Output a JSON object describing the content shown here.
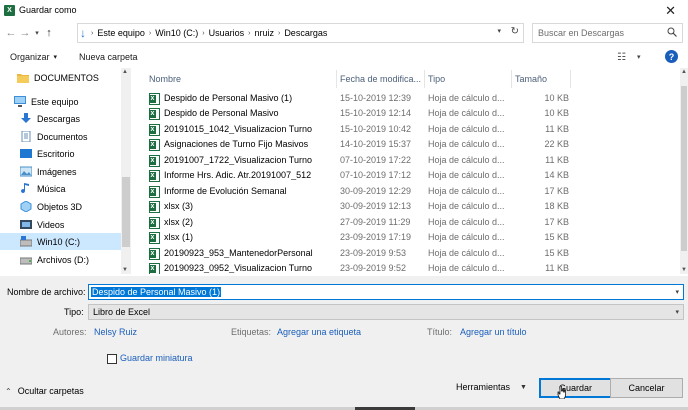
{
  "window": {
    "title": "Guardar como",
    "app_icon": "excel-icon",
    "close_glyph": "✕"
  },
  "breadcrumbs": [
    "Este equipo",
    "Win10 (C:)",
    "Usuarios",
    "nruiz",
    "Descargas"
  ],
  "search": {
    "placeholder": "Buscar en Descargas"
  },
  "toolbar": {
    "organize_label": "Organizar",
    "new_folder_label": "Nueva carpeta",
    "help_glyph": "?"
  },
  "nav": {
    "items": [
      {
        "label": "DOCUMENTOS",
        "icon": "folder-icon",
        "selected": false
      },
      {
        "label": "Este equipo",
        "icon": "computer-icon",
        "selected": false
      },
      {
        "label": "Descargas",
        "icon": "download-icon",
        "selected": false
      },
      {
        "label": "Documentos",
        "icon": "documents-icon",
        "selected": false
      },
      {
        "label": "Escritorio",
        "icon": "desktop-icon",
        "selected": false
      },
      {
        "label": "Imágenes",
        "icon": "pictures-icon",
        "selected": false
      },
      {
        "label": "Música",
        "icon": "music-icon",
        "selected": false
      },
      {
        "label": "Objetos 3D",
        "icon": "objects3d-icon",
        "selected": false
      },
      {
        "label": "Videos",
        "icon": "videos-icon",
        "selected": false
      },
      {
        "label": "Win10 (C:)",
        "icon": "drive-icon",
        "selected": true
      },
      {
        "label": "Archivos (D:)",
        "icon": "drive-icon",
        "selected": false
      }
    ]
  },
  "columns": {
    "name": "Nombre",
    "date": "Fecha de modifica...",
    "type": "Tipo",
    "size": "Tamaño"
  },
  "files": [
    {
      "name": "Despido de Personal Masivo (1)",
      "date": "15-10-2019 12:39",
      "type": "Hoja de cálculo d...",
      "size": "10 KB"
    },
    {
      "name": "Despido de Personal Masivo",
      "date": "15-10-2019 12:14",
      "type": "Hoja de cálculo d...",
      "size": "10 KB"
    },
    {
      "name": "20191015_1042_Visualizacion Turno",
      "date": "15-10-2019 10:42",
      "type": "Hoja de cálculo d...",
      "size": "11 KB"
    },
    {
      "name": "Asignaciones de Turno Fijo Masivos",
      "date": "14-10-2019 15:37",
      "type": "Hoja de cálculo d...",
      "size": "22 KB"
    },
    {
      "name": "20191007_1722_Visualizacion Turno",
      "date": "07-10-2019 17:22",
      "type": "Hoja de cálculo d...",
      "size": "11 KB"
    },
    {
      "name": "Informe Hrs. Adic. Atr.20191007_512",
      "date": "07-10-2019 17:12",
      "type": "Hoja de cálculo d...",
      "size": "14 KB"
    },
    {
      "name": "Informe de Evolución Semanal",
      "date": "30-09-2019 12:29",
      "type": "Hoja de cálculo d...",
      "size": "17 KB"
    },
    {
      "name": "xlsx (3)",
      "date": "30-09-2019 12:13",
      "type": "Hoja de cálculo d...",
      "size": "18 KB"
    },
    {
      "name": "xlsx (2)",
      "date": "27-09-2019 11:29",
      "type": "Hoja de cálculo d...",
      "size": "17 KB"
    },
    {
      "name": "xlsx (1)",
      "date": "23-09-2019 17:19",
      "type": "Hoja de cálculo d...",
      "size": "15 KB"
    },
    {
      "name": "20190923_953_MantenedorPersonal",
      "date": "23-09-2019 9:53",
      "type": "Hoja de cálculo d...",
      "size": "15 KB"
    },
    {
      "name": "20190923_0952_Visualizacion Turno",
      "date": "23-09-2019 9:52",
      "type": "Hoja de cálculo d...",
      "size": "11 KB"
    }
  ],
  "form": {
    "filename_label": "Nombre de archivo:",
    "filename_value": "Despido de Personal Masivo (1)",
    "type_label": "Tipo:",
    "type_value": "Libro de Excel",
    "authors_label": "Autores:",
    "authors_value": "Nelsy Ruiz",
    "tags_label": "Etiquetas:",
    "tags_value": "Agregar una etiqueta",
    "title_label": "Título:",
    "title_value": "Agregar un título",
    "thumbnail_label": "Guardar miniatura",
    "thumbnail_checked": false
  },
  "footer": {
    "hide_folders_label": "Ocultar carpetas",
    "tools_label": "Herramientas",
    "save_label": "Guardar",
    "cancel_label": "Cancelar"
  },
  "colors": {
    "accent": "#0078d7",
    "selection": "#cce8ff",
    "link": "#1a5ebc",
    "excel_green": "#1d6f42"
  }
}
